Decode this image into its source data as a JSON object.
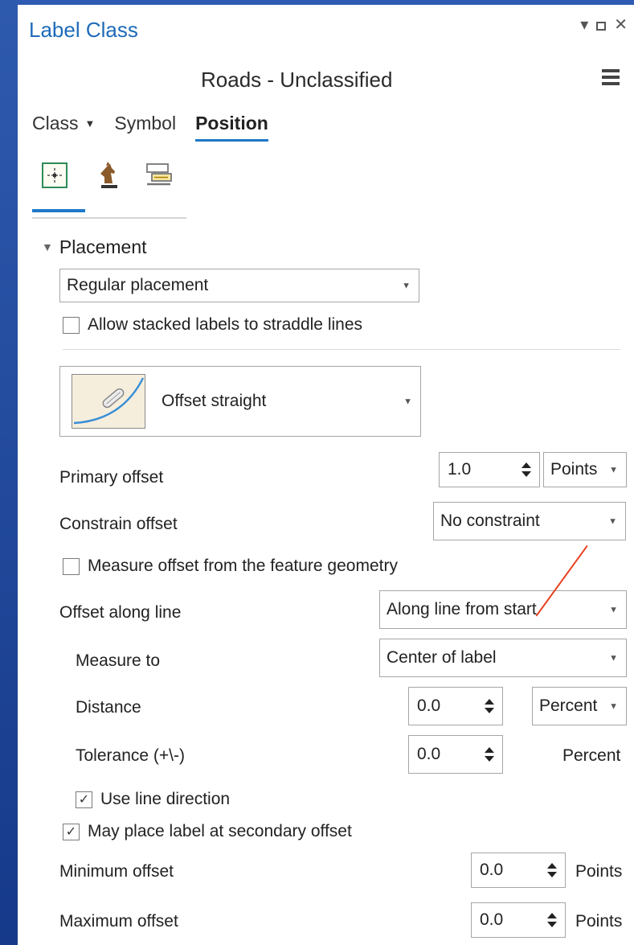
{
  "panel": {
    "title": "Label Class",
    "window_controls": {
      "dropdown": "▾",
      "close": "✕"
    },
    "layer_name": "Roads - Unclassified"
  },
  "tabs": [
    {
      "label": "Class",
      "has_caret": true
    },
    {
      "label": "Symbol"
    },
    {
      "label": "Position",
      "active": true
    }
  ],
  "subtabs": [
    {
      "icon": "position-crosshair-icon",
      "active": true
    },
    {
      "icon": "chess-knight-icon"
    },
    {
      "icon": "fitting-strategy-icon"
    }
  ],
  "placement": {
    "header": "Placement",
    "placement_type": "Regular placement",
    "allow_stacked_straddle": {
      "label": "Allow stacked labels to straddle lines",
      "checked": false
    },
    "position_style": "Offset straight",
    "primary_offset": {
      "label": "Primary offset",
      "value": "1.0",
      "unit": "Points"
    },
    "constrain_offset": {
      "label": "Constrain offset",
      "value": "No constraint"
    },
    "measure_from_geometry": {
      "label": "Measure offset from the feature geometry",
      "checked": false
    },
    "offset_along_line": {
      "label": "Offset along line",
      "value": "Along line from start"
    },
    "measure_to": {
      "label": "Measure to",
      "value": "Center of label"
    },
    "distance": {
      "label": "Distance",
      "value": "0.0",
      "unit": "Percent"
    },
    "tolerance": {
      "label": "Tolerance (+\\-)",
      "value": "0.0",
      "unit": "Percent"
    },
    "use_line_direction": {
      "label": "Use line direction",
      "checked": true
    },
    "secondary_offset": {
      "label": "May place label at secondary offset",
      "checked": true
    },
    "minimum_offset": {
      "label": "Minimum offset",
      "value": "0.0",
      "unit": "Points"
    },
    "maximum_offset": {
      "label": "Maximum offset",
      "value": "0.0",
      "unit": "Points"
    }
  },
  "colors": {
    "accent": "#1e78c8",
    "title": "#1e6bb8",
    "frame": "#1a3d8f",
    "annotation": "#e8401f"
  }
}
